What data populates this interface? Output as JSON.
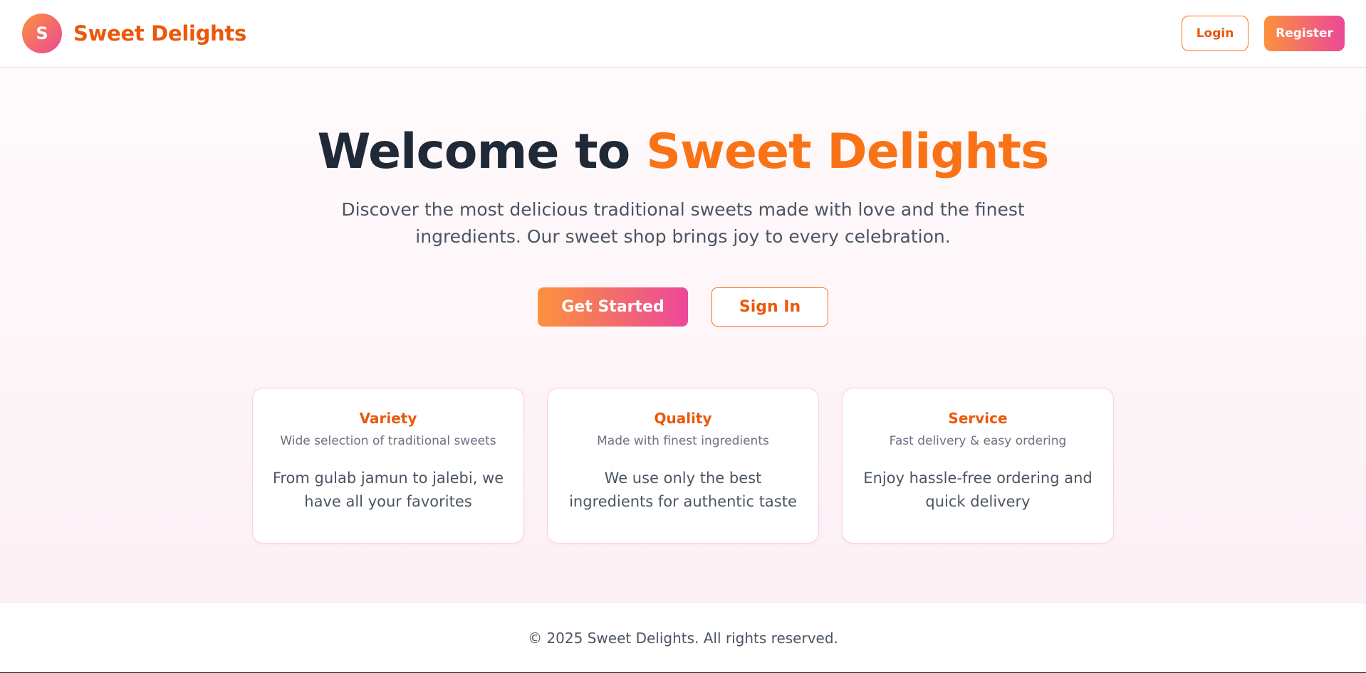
{
  "header": {
    "logo_letter": "S",
    "brand_name": "Sweet Delights",
    "login_label": "Login",
    "register_label": "Register"
  },
  "hero": {
    "title_prefix": "Welcome to",
    "title_accent": "Sweet Delights",
    "subtitle": "Discover the most delicious traditional sweets made with love and the finest ingredients. Our sweet shop brings joy to every celebration.",
    "get_started_label": "Get Started",
    "sign_in_label": "Sign In"
  },
  "features": [
    {
      "title": "Variety",
      "subtitle": "Wide selection of traditional sweets",
      "body": "From gulab jamun to jalebi, we have all your favorites"
    },
    {
      "title": "Quality",
      "subtitle": "Made with finest ingredients",
      "body": "We use only the best ingredients for authentic taste"
    },
    {
      "title": "Service",
      "subtitle": "Fast delivery & easy ordering",
      "body": "Enjoy hassle-free ordering and quick delivery"
    }
  ],
  "footer": {
    "copyright": "© 2025 Sweet Delights. All rights reserved."
  },
  "colors": {
    "brand_orange": "#ea580c",
    "accent_orange": "#f97316",
    "gradient_start": "#fb923c",
    "gradient_end": "#ec4899",
    "heading_dark": "#1f2937"
  }
}
